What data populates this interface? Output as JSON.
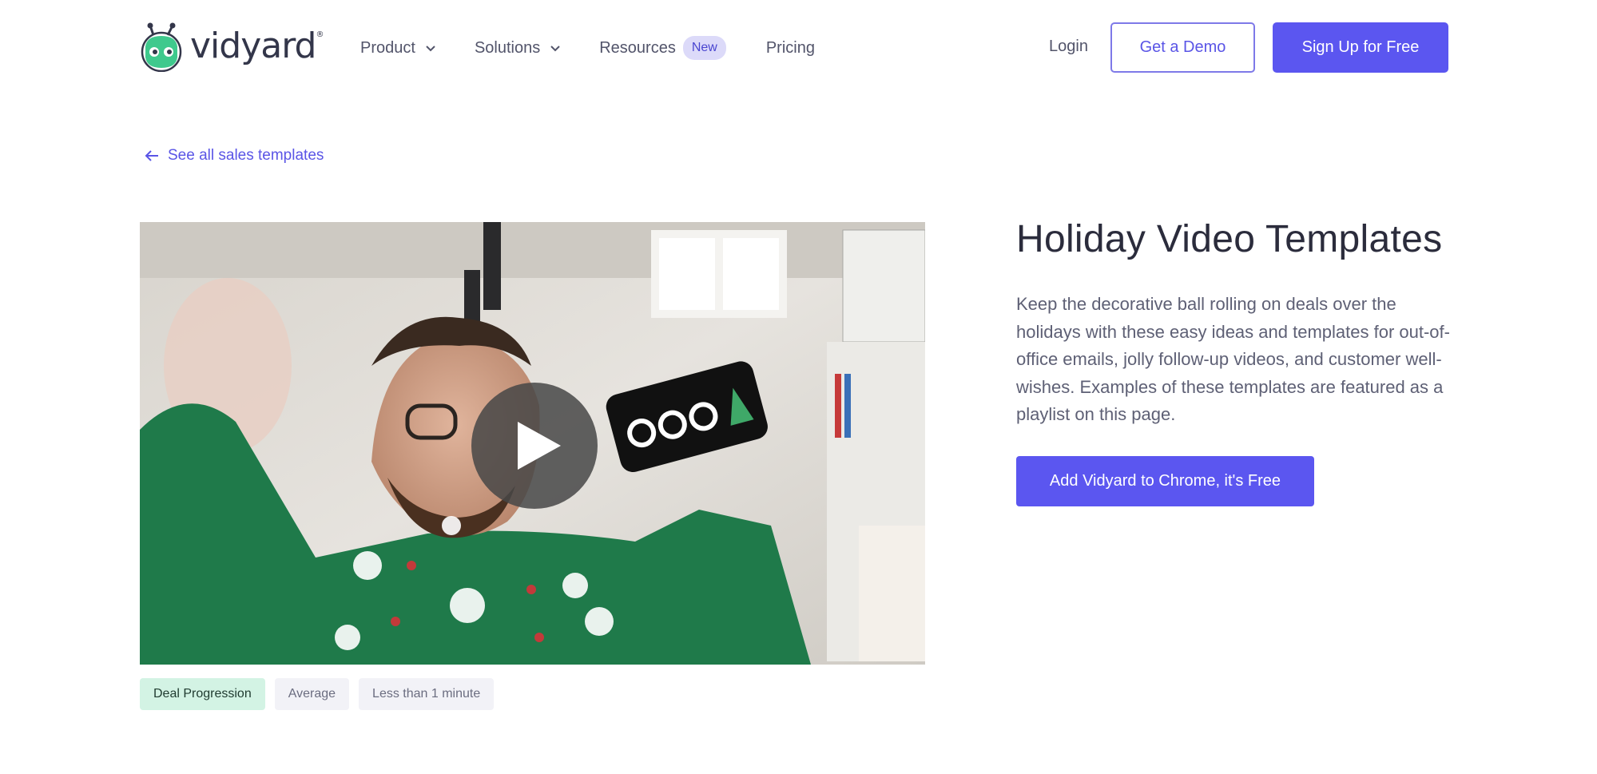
{
  "header": {
    "logo_text": "vidyard",
    "logo_reg": "®",
    "nav": [
      {
        "label": "Product",
        "has_dropdown": true
      },
      {
        "label": "Solutions",
        "has_dropdown": true
      },
      {
        "label": "Resources",
        "badge": "New"
      },
      {
        "label": "Pricing"
      }
    ],
    "login_label": "Login",
    "demo_label": "Get a Demo",
    "signup_label": "Sign Up for Free"
  },
  "back_link": {
    "icon": "arrow-left-icon",
    "label": "See all sales templates"
  },
  "video": {
    "play_icon": "play-icon",
    "phone_text": "OOO"
  },
  "tags": [
    {
      "label": "Deal Progression",
      "color": "#d3f3e4"
    },
    {
      "label": "Average",
      "color": "#f2f2f7"
    },
    {
      "label": "Less than 1 minute",
      "color": "#f2f2f7"
    }
  ],
  "content": {
    "title": "Holiday Video Templates",
    "description": "Keep the decorative ball rolling on deals over the holidays with these easy ideas and templates for out-of-office emails, jolly follow-up videos, and customer well-wishes. Examples of these templates are featured as a playlist on this page.",
    "cta_label": "Add Vidyard to Chrome, it's Free"
  },
  "colors": {
    "brand": "#5b56f0",
    "brand_green": "#3fc98d",
    "badge_bg": "#dcdaf9"
  }
}
